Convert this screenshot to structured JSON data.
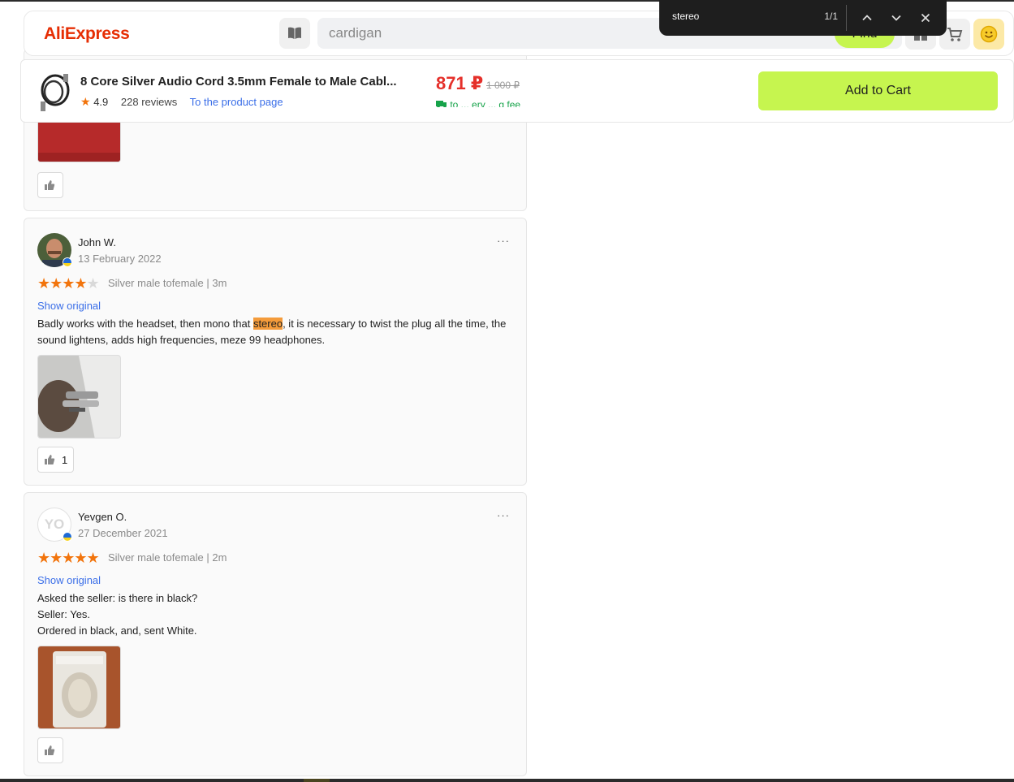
{
  "header": {
    "logo": "AliExpress",
    "search_value": "cardigan",
    "find_label": "Find",
    "icons": [
      "catalog-icon",
      "coupon-icon",
      "cart-icon",
      "smiley-account-icon"
    ]
  },
  "find_bar": {
    "query": "stereo",
    "count": "1/1"
  },
  "product": {
    "title": "8 Core Silver Audio Cord 3.5mm Female to Male Cabl...",
    "rating": "4.9",
    "reviews": "228 reviews",
    "product_link": "To the product page",
    "price": "871 ₽",
    "old_price": "1 000 ₽",
    "delivery": "to ... ery ... g fee",
    "add_to_cart": "Add to Cart"
  },
  "reviews": [
    {
      "like_count": ""
    },
    {
      "name": "John W.",
      "date": "13 February 2022",
      "rating": 4,
      "sku": "Silver male tofemale | 3m",
      "show_original": "Show original",
      "text_before": "Badly works with the headset, then mono that ",
      "text_highlight": "stereo",
      "text_after": ", it is necessary to twist the plug all the time, the sound lightens, adds high frequencies, meze 99 headphones.",
      "like_count": "1"
    },
    {
      "name": "Yevgen O.",
      "initials": "YO",
      "date": "27 December 2021",
      "rating": 5,
      "sku": "Silver male tofemale | 2m",
      "show_original": "Show original",
      "lines": [
        "Asked the seller: is there in black?",
        "Seller: Yes.",
        "Ordered in black, and, sent White."
      ],
      "like_count": ""
    }
  ],
  "more_label": "···",
  "colors": {
    "brand": "#e62e04",
    "accent_green": "#c6f54f",
    "price_red": "#e5302a",
    "star_orange": "#f2740c",
    "link_blue": "#3a6ee8",
    "highlight": "#f49b3b"
  }
}
